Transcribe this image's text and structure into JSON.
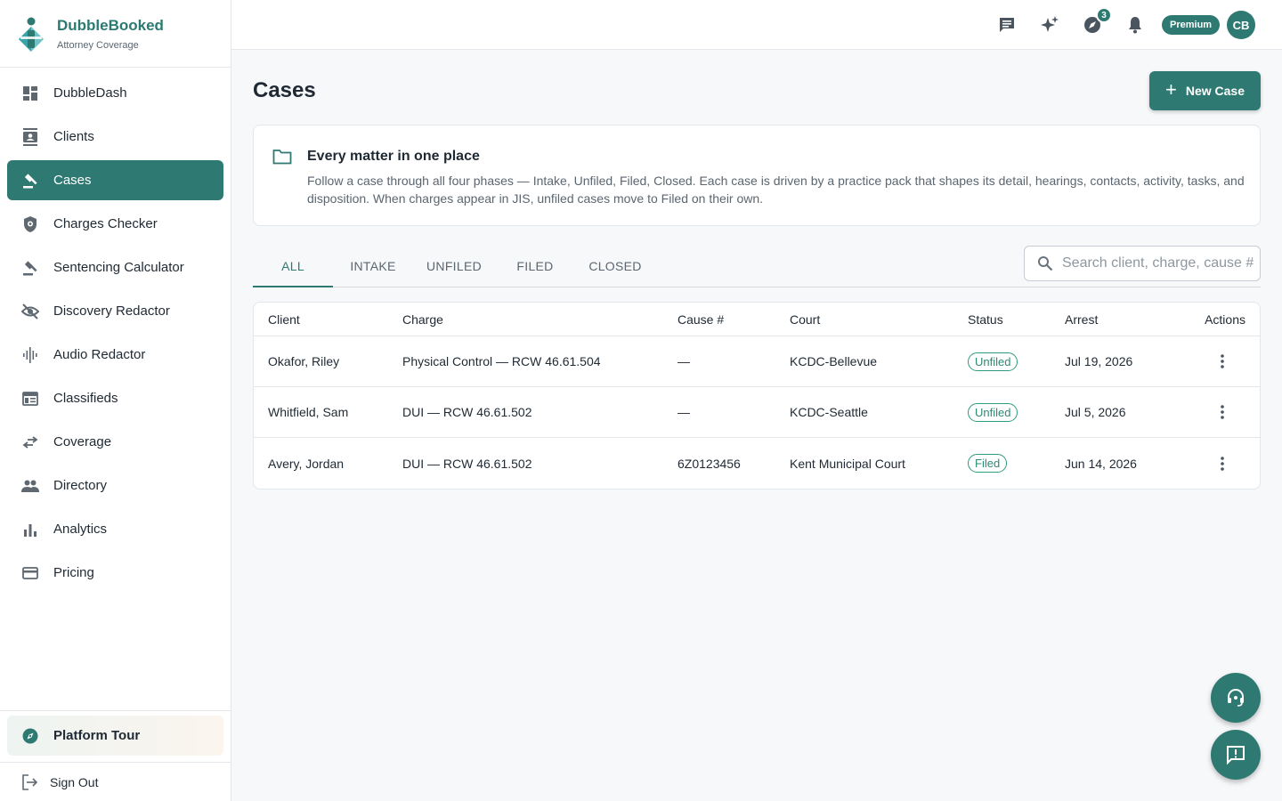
{
  "brand": {
    "name": "DubbleBooked",
    "subtitle": "Attorney Coverage"
  },
  "sidebar": {
    "items": [
      {
        "label": "DubbleDash",
        "icon": "dashboard-icon"
      },
      {
        "label": "Clients",
        "icon": "contact-card-icon"
      },
      {
        "label": "Cases",
        "icon": "gavel-icon",
        "active": true
      },
      {
        "label": "Charges Checker",
        "icon": "shield-icon"
      },
      {
        "label": "Sentencing Calculator",
        "icon": "gavel-icon"
      },
      {
        "label": "Discovery Redactor",
        "icon": "eye-off-icon"
      },
      {
        "label": "Audio Redactor",
        "icon": "audio-wave-icon"
      },
      {
        "label": "Classifieds",
        "icon": "listing-icon"
      },
      {
        "label": "Coverage",
        "icon": "swap-arrows-icon"
      },
      {
        "label": "Directory",
        "icon": "people-icon"
      },
      {
        "label": "Analytics",
        "icon": "bar-chart-icon"
      },
      {
        "label": "Pricing",
        "icon": "credit-card-icon"
      }
    ],
    "tour_label": "Platform Tour",
    "signout_label": "Sign Out"
  },
  "topbar": {
    "notification_count": "3",
    "premium_label": "Premium",
    "avatar_initials": "CB"
  },
  "page": {
    "title": "Cases",
    "new_case_label": "New Case"
  },
  "info": {
    "title": "Every matter in one place",
    "body": "Follow a case through all four phases — Intake, Unfiled, Filed, Closed. Each case is driven by a practice pack that shapes its detail, hearings, contacts, activity, tasks, and disposition. When charges appear in JIS, unfiled cases move to Filed on their own."
  },
  "tabs": [
    "ALL",
    "INTAKE",
    "UNFILED",
    "FILED",
    "CLOSED"
  ],
  "active_tab": "ALL",
  "search": {
    "placeholder": "Search client, charge, cause #",
    "value": ""
  },
  "table": {
    "headers": {
      "client": "Client",
      "charge": "Charge",
      "cause": "Cause #",
      "court": "Court",
      "status": "Status",
      "arrest": "Arrest",
      "actions": "Actions"
    },
    "rows": [
      {
        "client": "Okafor, Riley",
        "charge": "Physical Control — RCW 46.61.504",
        "cause": "—",
        "court": "KCDC-Bellevue",
        "status": "Unfiled",
        "arrest": "Jul 19, 2026"
      },
      {
        "client": "Whitfield, Sam",
        "charge": "DUI — RCW 46.61.502",
        "cause": "—",
        "court": "KCDC-Seattle",
        "status": "Unfiled",
        "arrest": "Jul 5, 2026"
      },
      {
        "client": "Avery, Jordan",
        "charge": "DUI — RCW 46.61.502",
        "cause": "6Z0123456",
        "court": "Kent Municipal Court",
        "status": "Filed",
        "arrest": "Jun 14, 2026"
      }
    ]
  },
  "colors": {
    "accent": "#2e7a72",
    "status_pill": "#2e9a7e"
  }
}
